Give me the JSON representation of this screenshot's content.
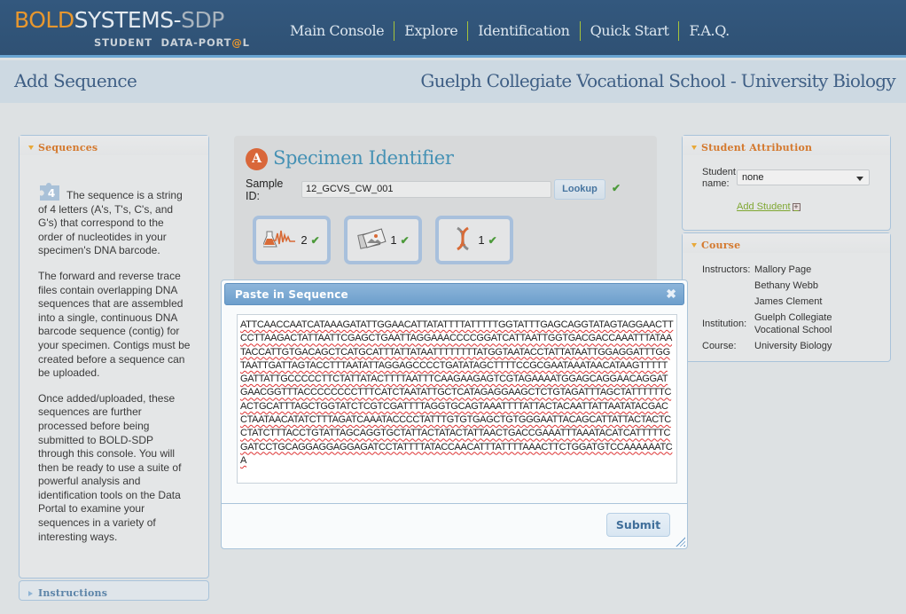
{
  "header": {
    "logo": {
      "part1": "BOLD",
      "part2": "SYSTEMS-",
      "part3": "SDP",
      "sub_before": "STUDENT  DATA-PORT",
      "sub_at": "@",
      "sub_after": "L"
    },
    "nav": [
      "Main Console",
      "Explore",
      "Identification",
      "Quick Start",
      "F.A.Q."
    ]
  },
  "subheader": {
    "page_title": "Add Sequence",
    "course_title": "Guelph Collegiate Vocational School - University Biology"
  },
  "left_panel": {
    "title": "Sequences",
    "step_number": "4",
    "paragraphs": [
      "The sequence is a string of 4 letters (A's, T's, C's, and G's) that correspond to the order of nucleotides in your specimen's DNA barcode.",
      "The forward and reverse trace files contain overlapping DNA sequences that are assembled into a single, continuous DNA barcode sequence (contig) for your specimen. Contigs must be created before a sequence can be uploaded.",
      "Once added/uploaded, these sequences are further processed before being submitted to BOLD-SDP through this console. You will then be ready to use a suite of powerful analysis and identification tools on the Data Portal to examine your sequences in a variety of interesting ways."
    ],
    "instructions_title": "Instructions"
  },
  "specimen": {
    "badge": "A",
    "title": "Specimen Identifier",
    "sample_label": "Sample ID:",
    "sample_id": "12_GCVS_CW_001",
    "lookup_label": "Lookup",
    "check": "✔",
    "tiles": [
      {
        "icon": "trace-file-icon",
        "count": "2",
        "check": "✔"
      },
      {
        "icon": "images-icon",
        "count": "1",
        "check": "✔"
      },
      {
        "icon": "dna-icon",
        "count": "1",
        "check": "✔"
      }
    ]
  },
  "student_attribution": {
    "title": "Student Attribution",
    "student_label": "Student name:",
    "student_value": "none",
    "add_student": "Add Student",
    "plus": "+"
  },
  "course": {
    "title": "Course",
    "instructors_label": "Instructors:",
    "instructors": [
      "Mallory Page",
      "Bethany Webb",
      "James Clement"
    ],
    "institution_label": "Institution:",
    "institution": "Guelph Collegiate Vocational School",
    "course_label": "Course:",
    "course": "University Biology"
  },
  "modal": {
    "title": "Paste in Sequence",
    "close": "✖",
    "sequence": "ATTCAACCAATCATAAAGATATTGGAACATTATATTTTATTTTTGGTATTTGAGCAGGTATAGTAGGAACTTCCTTAAGACTATTAATTCGAGCTGAATTAGGAAACCCCGGATCATTAATTGGTGACGACCAAATTTATAATACCATTGTGACAGCTCATGCATTTATTATAATTTTTTTTATGGTAATACCTATTATAATTGGAGGATTTGGTAATTGATTAGTACCTTTAATATTAGGAGCCCCTGATATAGCTTTTCCGCGAATAAATAACATAAGTTTTTGATTATTGCCCCCTTCTATTATACTTTTAATTTCAAGAAGAGTCGTAGAAAATGGAGCAGGAACAGGATGAACGGTTTACCCCCCCCTTTCATCTAATATTGCTCATAGAGGAAGCTCTGTAGATTTAGCTATTTTTTCACTGCATTTAGCTGGTATCTCGTCGATTTTAGGTGCAGTAAATTTTATTACTACAATTATTAATATACGACCTAATAACATATCTTTAGATCAAATACCCCTATTTGTGTGAGCTGTGGGAATTACAGCATTATTACTACTCCTATCTTTACCTGTATTAGCAGGTGCTATTACTATACTATTAACTGACCGAAATTTAAATACATCATTTTTCGATCCTGCAGGAGGAGGAGATCCTATTTTATACCAACATTTATTTTAAACTTCTGGATGTCCAAAAAATCA",
    "submit_label": "Submit"
  }
}
